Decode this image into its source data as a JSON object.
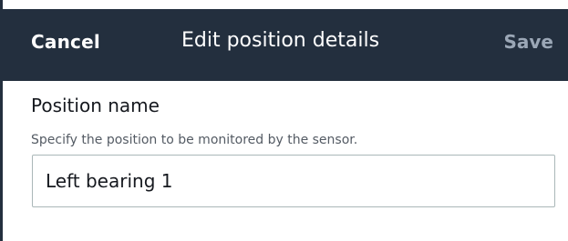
{
  "header": {
    "cancel_label": "Cancel",
    "title": "Edit position details",
    "save_label": "Save"
  },
  "form": {
    "position_name": {
      "label": "Position name",
      "description": "Specify the position to be monitored by the sensor.",
      "value": "Left bearing 1"
    }
  },
  "colors": {
    "header_bg": "#232f3e",
    "header_text": "#ffffff",
    "save_disabled": "#9ba7b6",
    "input_border": "#aab7b8"
  }
}
